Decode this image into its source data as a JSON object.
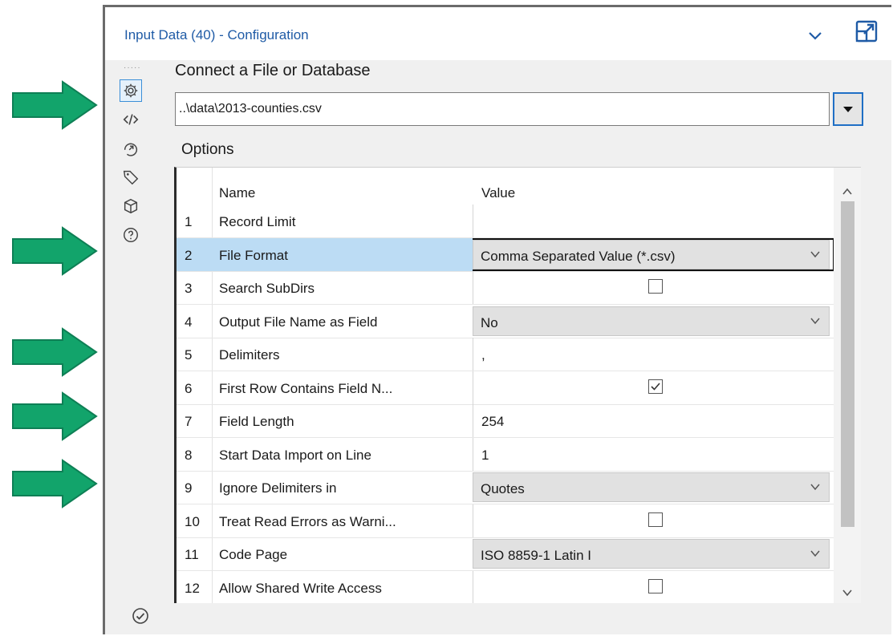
{
  "window": {
    "title": "Input Data (40) - Configuration"
  },
  "sidebar": {
    "icons": [
      "gear-icon",
      "code-icon",
      "annotation-icon",
      "tag-icon",
      "cube-icon",
      "help-icon"
    ],
    "bottom_icon": "check-circle-icon"
  },
  "connect": {
    "heading": "Connect a File or Database",
    "file_path": "..\\data\\2013-counties.csv"
  },
  "options": {
    "heading": "Options",
    "columns": {
      "name": "Name",
      "value": "Value"
    },
    "rows": [
      {
        "num": "1",
        "name": "Record Limit",
        "value": "",
        "kind": "text"
      },
      {
        "num": "2",
        "name": "File Format",
        "value": "Comma Separated Value (*.csv)",
        "kind": "select",
        "selected": true
      },
      {
        "num": "3",
        "name": "Search SubDirs",
        "value": "",
        "kind": "checkbox",
        "checked": false
      },
      {
        "num": "4",
        "name": "Output File Name as Field",
        "value": "No",
        "kind": "select"
      },
      {
        "num": "5",
        "name": "Delimiters",
        "value": ",",
        "kind": "text"
      },
      {
        "num": "6",
        "name": "First Row Contains Field N...",
        "value": "",
        "kind": "checkbox",
        "checked": true
      },
      {
        "num": "7",
        "name": "Field Length",
        "value": "254",
        "kind": "text"
      },
      {
        "num": "8",
        "name": "Start Data Import on Line",
        "value": "1",
        "kind": "text"
      },
      {
        "num": "9",
        "name": "Ignore Delimiters in",
        "value": "Quotes",
        "kind": "select"
      },
      {
        "num": "10",
        "name": "Treat Read Errors as Warni...",
        "value": "",
        "kind": "checkbox",
        "checked": false
      },
      {
        "num": "11",
        "name": "Code Page",
        "value": "ISO 8859-1 Latin I",
        "kind": "select"
      },
      {
        "num": "12",
        "name": "Allow Shared Write Access",
        "value": "",
        "kind": "checkbox",
        "checked": false
      }
    ]
  },
  "colors": {
    "accent": "#1f6fc5",
    "arrow": "#12a46b",
    "selection": "#bcdcf4"
  }
}
